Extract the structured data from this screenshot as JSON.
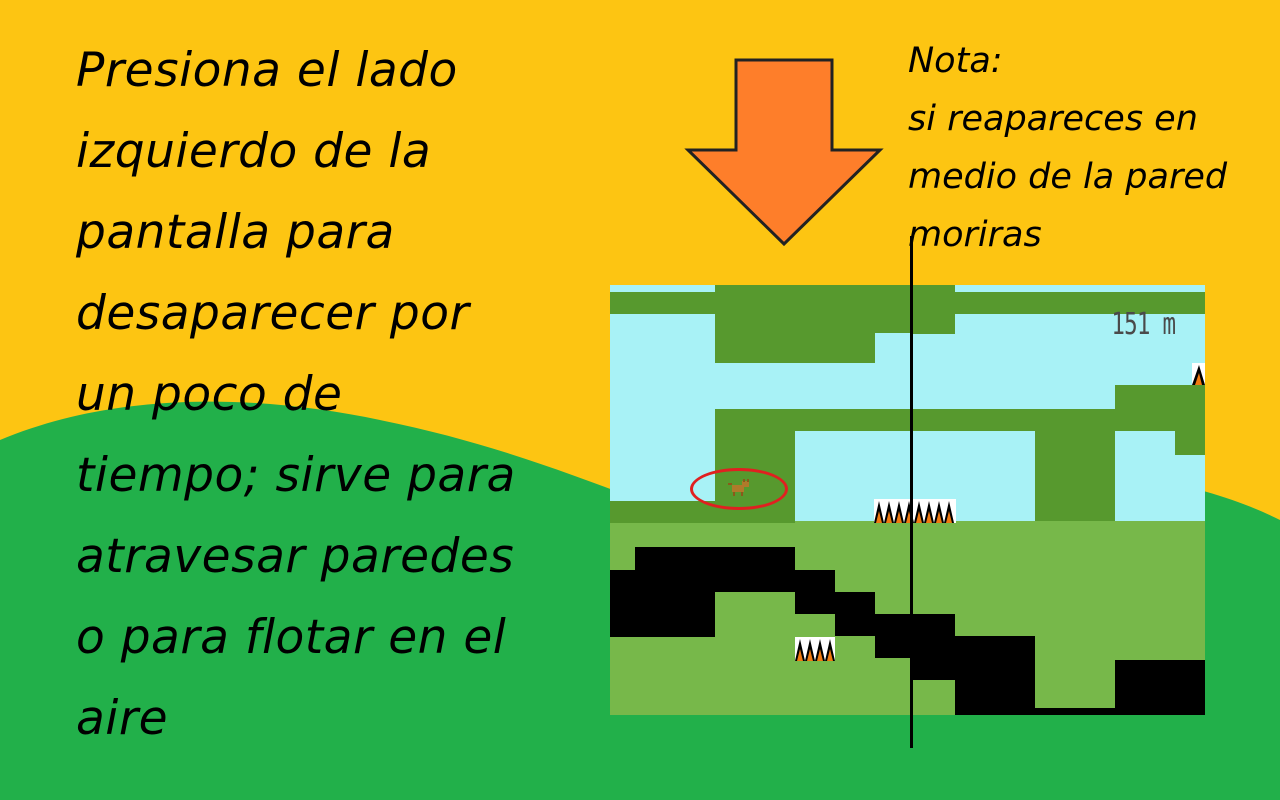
{
  "instructions": {
    "lines": [
      "Presiona el lado",
      "izquierdo de la",
      "pantalla para",
      "desaparecer por",
      "un poco de",
      "tiempo; sirve para",
      "atravesar paredes",
      "o para flotar en el",
      "aire"
    ]
  },
  "note": {
    "lines": [
      "Nota:",
      "si reapareces en",
      "medio de la pared",
      "moriras"
    ]
  },
  "game": {
    "distance": "151 m"
  },
  "colors": {
    "sky_yellow": "#fdc512",
    "hill_green": "#22b04a",
    "arrow_orange": "#fe7e2a",
    "game_sky": "#a8f2f6",
    "dark_green": "#57992e",
    "light_green": "#77b84a",
    "wall_black": "#000000",
    "highlight_red": "#e02020"
  },
  "icons": {
    "arrow": "down-arrow-icon",
    "player": "cat-player-icon",
    "hazard": "spike-fire-icon"
  }
}
